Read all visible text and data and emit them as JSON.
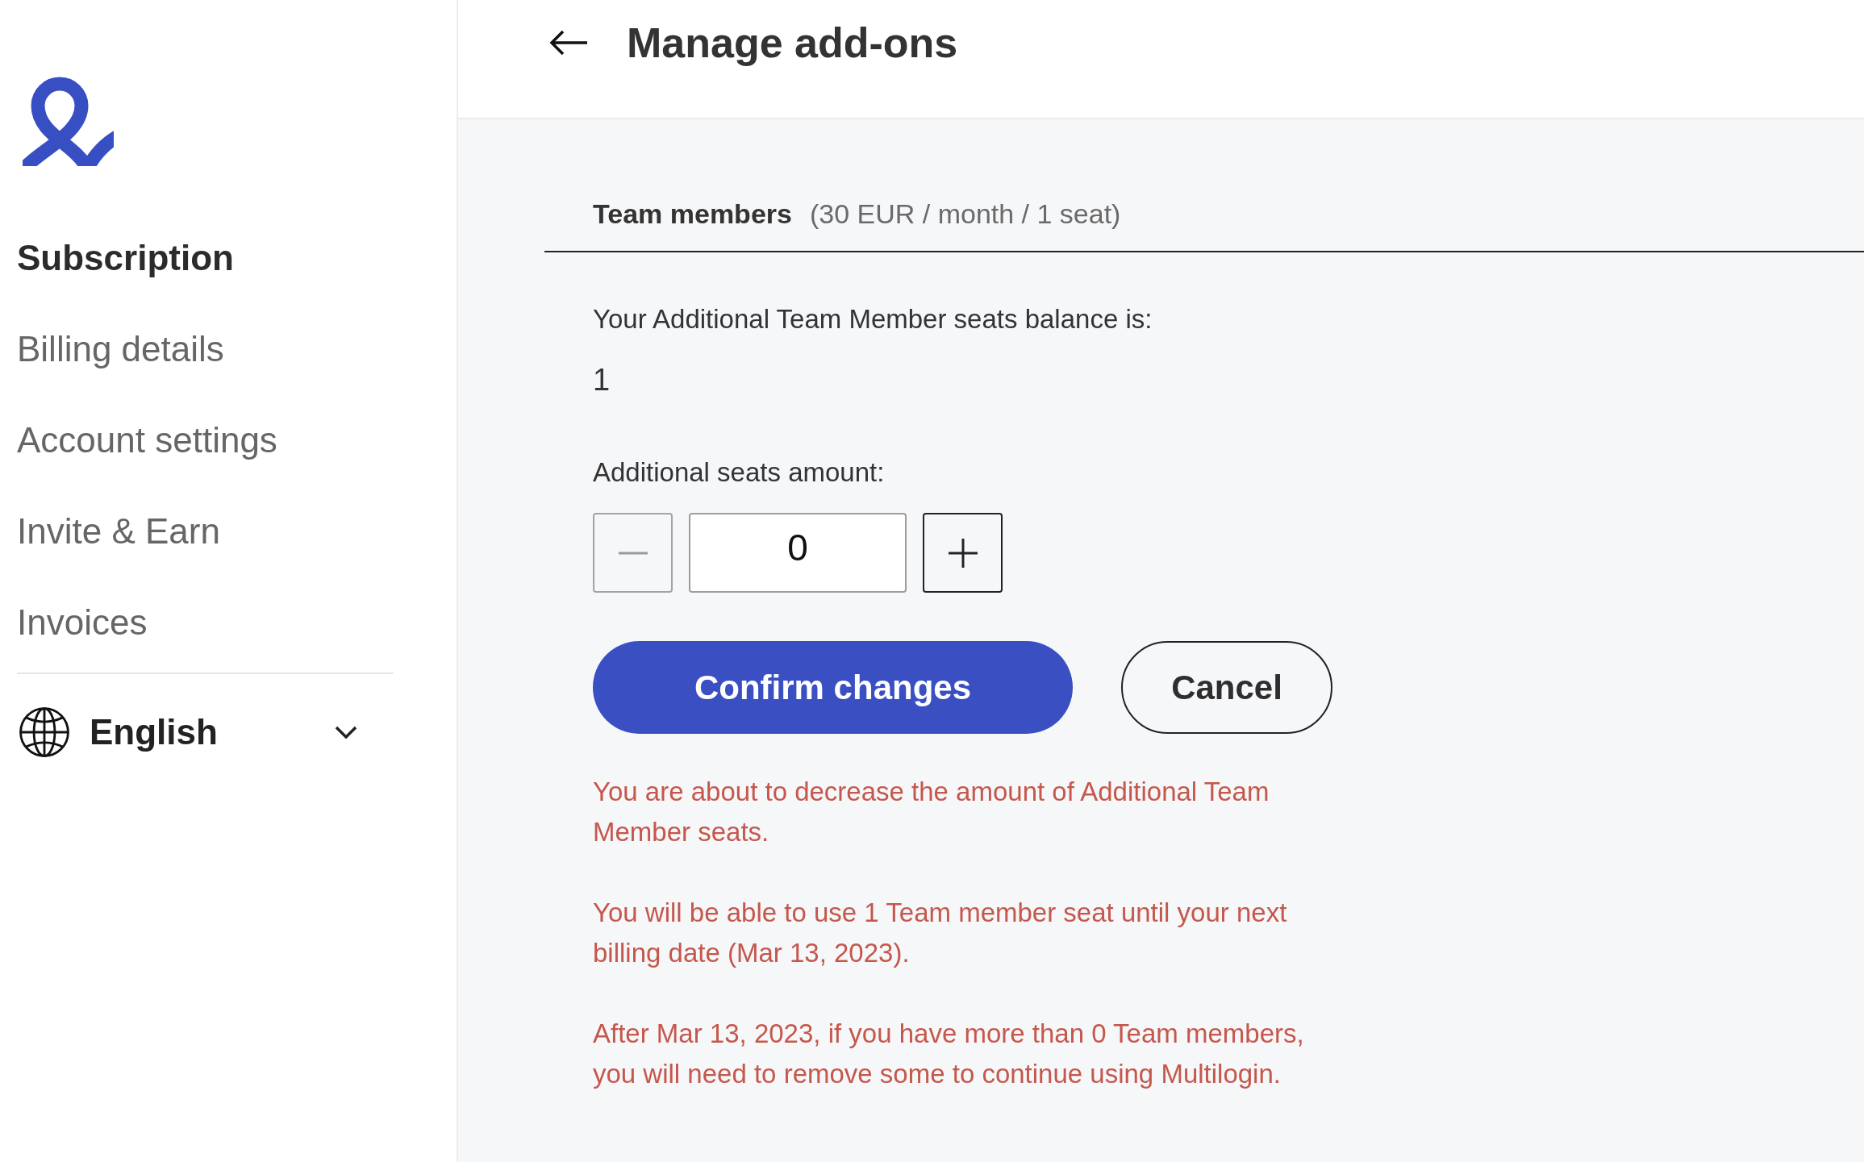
{
  "sidebar": {
    "items": [
      {
        "label": "Subscription",
        "selected": true
      },
      {
        "label": "Billing details",
        "selected": false
      },
      {
        "label": "Account settings",
        "selected": false
      },
      {
        "label": "Invite & Earn",
        "selected": false
      },
      {
        "label": "Invoices",
        "selected": false
      }
    ],
    "language": {
      "label": "English"
    }
  },
  "header": {
    "title": "Manage add-ons"
  },
  "section": {
    "title": "Team members",
    "price": "(30 EUR / month / 1 seat)"
  },
  "balance": {
    "label": "Your Additional Team Member seats balance is:",
    "value": "1"
  },
  "amount": {
    "label": "Additional seats amount:",
    "value": "0",
    "decrement": {
      "disabled": true
    },
    "increment": {
      "disabled": false
    }
  },
  "buttons": [
    {
      "label": "Confirm changes",
      "kind": "primary"
    },
    {
      "label": "Cancel",
      "kind": "secondary"
    }
  ],
  "warnings": [
    "You are about to decrease the amount of Additional Team Member seats.",
    "You will be able to use 1 Team member seat until your next billing date (Mar 13, 2023).",
    "After Mar 13, 2023, if you have more than 0 Team members, you will need to remove some to continue using Multilogin."
  ]
}
